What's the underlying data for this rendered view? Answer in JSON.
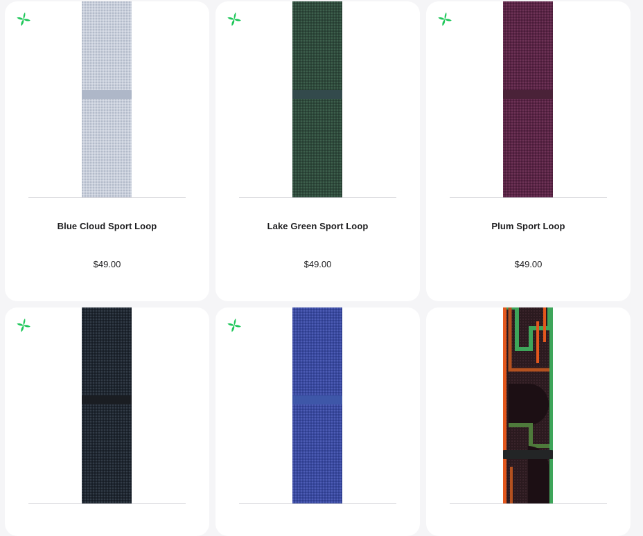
{
  "products": [
    {
      "name": "Blue Cloud Sport Loop",
      "price": "$49.00",
      "color": "#c9cfdb",
      "weave": "#b3bbca",
      "buckle": "#aeb7c8",
      "icon": "eco-leaf-icon"
    },
    {
      "name": "Lake Green Sport Loop",
      "price": "$49.00",
      "color": "#2f4a3c",
      "weave": "#3d5f4c",
      "buckle": "#334a4c",
      "icon": "eco-leaf-icon"
    },
    {
      "name": "Plum Sport Loop",
      "price": "$49.00",
      "color": "#5a2546",
      "weave": "#6d3356",
      "buckle": "#4a2238",
      "icon": "eco-leaf-icon"
    },
    {
      "name": "",
      "price": "",
      "color": "#1f2731",
      "weave": "#323b46",
      "buckle": "#1a1d22",
      "icon": "eco-leaf-icon"
    },
    {
      "name": "",
      "price": "",
      "color": "#3a4aa0",
      "weave": "#4d5cb3",
      "buckle": "#3e57a8",
      "icon": "eco-leaf-icon"
    },
    {
      "name": "",
      "price": "",
      "color": "#2b1a1f",
      "weave": "#e3571d",
      "buckle": "#232526",
      "icon": ""
    }
  ],
  "colors": {
    "eco_green": "#1fc75a",
    "card_bg": "#ffffff",
    "page_bg": "#f5f5f7"
  }
}
